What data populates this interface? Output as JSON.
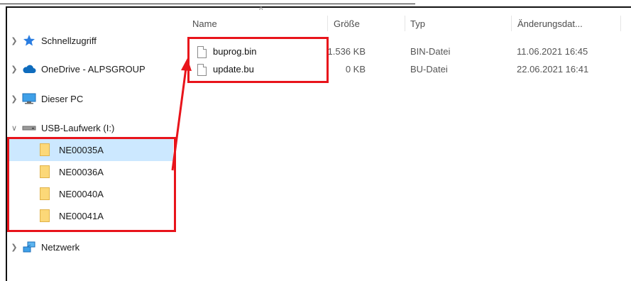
{
  "nav": {
    "quick_access": "Schnellzugriff",
    "onedrive": "OneDrive - ALPSGROUP",
    "this_pc": "Dieser PC",
    "usb": "USB-Laufwerk (I:)",
    "folders": [
      "NE00035A",
      "NE00036A",
      "NE00040A",
      "NE00041A"
    ],
    "network": "Netzwerk"
  },
  "columns": {
    "name": "Name",
    "size": "Größe",
    "type": "Typ",
    "modified": "Änderungsdat..."
  },
  "files": [
    {
      "name": "buprog.bin",
      "size": "1.536 KB",
      "type": "BIN-Datei",
      "modified": "11.06.2021 16:45"
    },
    {
      "name": "update.bu",
      "size": "0 KB",
      "type": "BU-Datei",
      "modified": "22.06.2021 16:41"
    }
  ],
  "colors": {
    "selection": "#cce8ff",
    "annotation": "#e8141b",
    "folder": "#fcd878"
  },
  "icons": {
    "quick_access": "star-icon",
    "onedrive": "cloud-icon",
    "this_pc": "monitor-icon",
    "usb": "drive-icon",
    "network": "network-icon"
  }
}
